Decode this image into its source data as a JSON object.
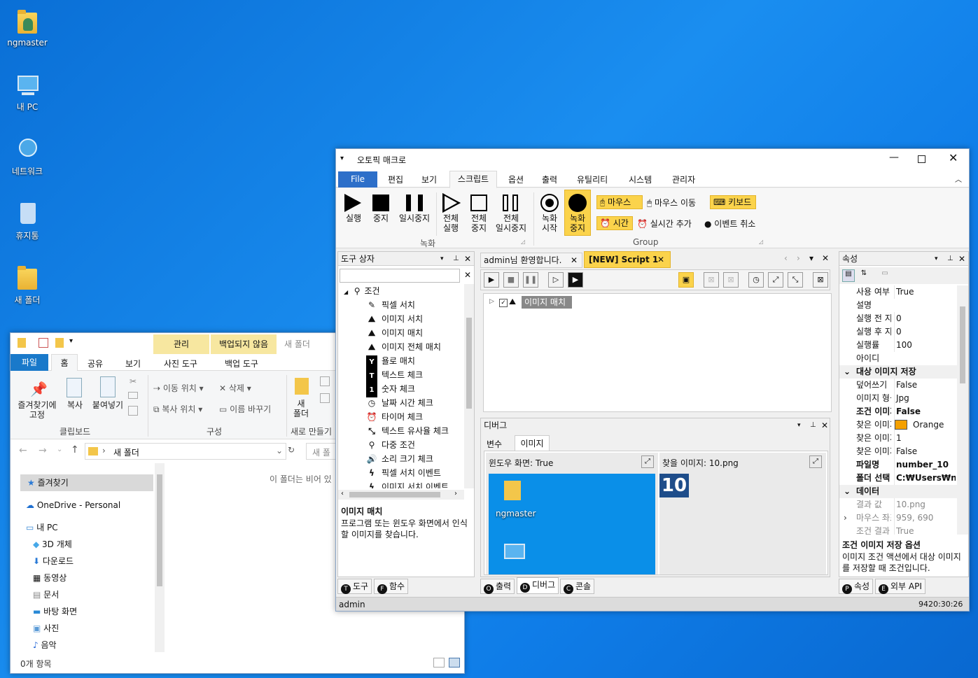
{
  "desktop": {
    "icons": [
      {
        "label": "ngmaster"
      },
      {
        "label": "내 PC"
      },
      {
        "label": "네트워크"
      },
      {
        "label": "휴지통"
      },
      {
        "label": "새 폴더"
      }
    ]
  },
  "explorer": {
    "title": "새 폴더",
    "ctx_tabs": {
      "manage": "관리",
      "backup": "백업되지 않음"
    },
    "tabs": [
      "파일",
      "홈",
      "공유",
      "보기",
      "사진 도구",
      "백업 도구"
    ],
    "ribbon": {
      "pin": "즐겨찾기에\n고정",
      "copy": "복사",
      "paste": "붙여넣기",
      "clipboard": "클립보드",
      "move_to": "이동 위치",
      "copy_to": "복사 위치",
      "delete": "삭제",
      "rename": "이름 바꾸기",
      "organize": "구성",
      "new_folder": "새\n폴더",
      "new_group": "새로 만들기"
    },
    "address": "새 폴더",
    "search_placeholder": "새 폴",
    "empty_msg": "이 폴더는 비어 있",
    "nav": [
      "즐겨찾기",
      "OneDrive - Personal",
      "내 PC",
      "3D 개체",
      "다운로드",
      "동영상",
      "문서",
      "바탕 화면",
      "사진",
      "음악"
    ],
    "status": "0개 항목"
  },
  "app": {
    "title": "오토픽 매크로",
    "menu": [
      "File",
      "편집",
      "보기",
      "스크립트",
      "옵션",
      "출력",
      "유틸리티",
      "시스템",
      "관리자"
    ],
    "ribbon": {
      "run": "실행",
      "stop": "중지",
      "pause": "일시중지",
      "run_all": "전체\n실행",
      "stop_all": "전체\n중지",
      "pause_all": "전체\n일시중지",
      "group_recording": "녹화",
      "rec_start": "녹화\n시작",
      "rec_stop": "녹화\n중지",
      "mouse": "마우스",
      "mouse_move": "마우스 이동",
      "keyboard": "키보드",
      "time": "시간",
      "add_realtime": "실시간 추가",
      "cancel_event": "이벤트 취소",
      "group": "Group"
    },
    "toolbox": {
      "title": "도구 상자",
      "root": "조건",
      "items": [
        "픽셀 서치",
        "이미지 서치",
        "이미지 매치",
        "이미지 전체 매치",
        "욜로 매치",
        "텍스트 체크",
        "숫자 체크",
        "날짜 시간 체크",
        "타이머 체크",
        "텍스트 유사율 체크",
        "다중 조건",
        "소리 크기 체크",
        "픽셀 서치 이벤트",
        "이미지 서치 이벤트"
      ],
      "desc_title": "이미지 매치",
      "desc": "프로그램 또는 윈도우 화면에서 인식할 이미지를 찾습니다.",
      "tabs": [
        "도구",
        "함수"
      ]
    },
    "doc_tabs": [
      "admin님 환영합니다.",
      "[NEW] Script 1"
    ],
    "script_node": "이미지 매치",
    "debugger": {
      "title": "디버그",
      "tabs": [
        "변수",
        "이미지"
      ],
      "window_screen": "윈도우 화면: True",
      "find_image": "찾을 이미지: 10.png",
      "preview_label": "ngmaster",
      "find_value": "10"
    },
    "bottom_tabs": [
      "출력",
      "디버그",
      "콘솔"
    ],
    "props": {
      "title": "속성",
      "rows": [
        {
          "k": "사용 여부",
          "v": "True"
        },
        {
          "k": "설명",
          "v": ""
        },
        {
          "k": "실행 전 지연",
          "v": "0"
        },
        {
          "k": "실행 후 지연",
          "v": "0"
        },
        {
          "k": "실행률",
          "v": "100"
        },
        {
          "k": "아이디",
          "v": ""
        }
      ],
      "cat1": "대상 이미지 저장",
      "rows2": [
        {
          "k": "덮어쓰기",
          "v": "False"
        },
        {
          "k": "이미지 형식",
          "v": "Jpg"
        },
        {
          "k": "조건 이미지",
          "v": "False"
        },
        {
          "k": "찾은 이미지",
          "v": "Orange"
        },
        {
          "k": "찾은 이미지",
          "v": "1"
        },
        {
          "k": "찾은 이미지",
          "v": "False"
        },
        {
          "k": "파일명",
          "v": "number_10"
        },
        {
          "k": "폴더 선택",
          "v": "C:₩Users₩ngm"
        }
      ],
      "cat2": "데이터",
      "rows3": [
        {
          "k": "결과 값",
          "v": "10.png"
        },
        {
          "k": "마우스 좌표",
          "v": "959, 690"
        },
        {
          "k": "조건 결과",
          "v": "True"
        }
      ],
      "desc_title": "조건 이미지 저장 옵션",
      "desc": "이미지 조건 액션에서 대상 이미지를 저장할 때 조건입니다.",
      "tabs": [
        "속성",
        "외부 API"
      ],
      "orange": "#f4a000"
    },
    "status_user": "admin",
    "status_time": "9420:30:26"
  },
  "colors": {
    "accent": "#1e6fd0",
    "highlight": "#fbd34b"
  }
}
